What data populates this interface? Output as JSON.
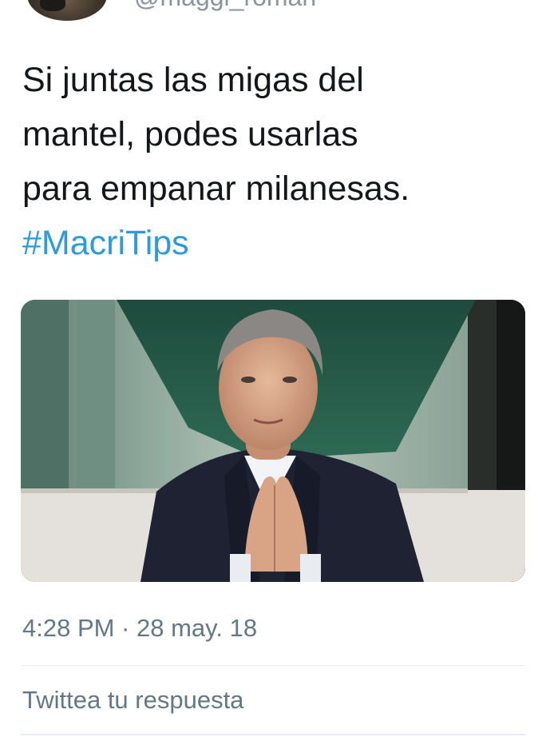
{
  "author": {
    "handle": "@maggi_roman",
    "avatar_icon": "user-avatar"
  },
  "tweet": {
    "lines": [
      "Si juntas las migas del",
      "mantel, podes usarlas",
      "para empanar milanesas."
    ],
    "hashtag": "#MacriTips",
    "timestamp": "4:28 PM · 28 may. 18"
  },
  "reply": {
    "placeholder": "Twittea tu respuesta"
  },
  "colors": {
    "text": "#14171a",
    "hashtag": "#2f9ad8",
    "muted": "#657786",
    "divider": "#e6ecf0"
  }
}
